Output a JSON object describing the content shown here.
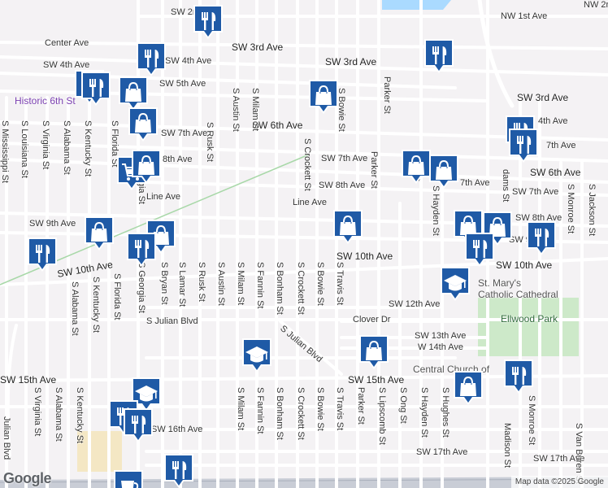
{
  "map": {
    "logo": "Google",
    "credit": "Map data ©2025 Google",
    "colors": {
      "water": "#aadaff",
      "park": "#cde9c9",
      "pin": "#1f5aa6",
      "road": "#ffffff",
      "highway": "#c9cdd6"
    }
  },
  "streets": {
    "sw_2nd": "SW 2nd Ave",
    "nw_1st": "NW 1st Ave",
    "nw_2nd": "NW 2n",
    "center": "Center Ave",
    "sw_3rd_a": "SW 3rd Ave",
    "sw_3rd_b": "SW 3rd Ave",
    "sw_3rd_c": "SW 3rd Ave",
    "sw_4th_a": "SW 4th Ave",
    "sw_4th_b": "SW 4th Ave",
    "sw_4th_c": "4th Ave",
    "sw_5th": "SW 5th Ave",
    "sw_6th_a": "SW 6th Ave",
    "sw_6th_b": "SW 6th Ave",
    "sw_7th_a": "SW 7th Ave",
    "sw_7th_b": "SW 7th Ave",
    "sw_7th_c": "SW 7th Ave",
    "sw_7th_d": "7th Ave",
    "sw_7th_e": "7th Ave",
    "sw_8th_a": "SW 8th Ave",
    "sw_8th_b": "SW 8th Ave",
    "sw_8th_c": "8th Ave",
    "line_a": "Line Ave",
    "line_b": "Line Ave",
    "sw_9th_a": "SW 9th Ave",
    "sw_9th_b": "SW 9",
    "sw_10th_a": "SW 10th Ave",
    "sw_10th_b": "SW 10th Ave",
    "sw_10th_c": "SW 10th Ave",
    "sw_12th": "SW 12th Ave",
    "sw_13th": "SW 13th Ave",
    "sw_14th": "W 14th Ave",
    "sw_15th_a": "SW 15th Ave",
    "sw_15th_b": "SW 15th Ave",
    "sw_16th": "SW 16th Ave",
    "sw_17th_a": "SW 17th Ave",
    "sw_17th_b": "SW 17th Ave",
    "julian_blvd": "S Julian Blvd",
    "julian_blvd_diag": "S Julian Blvd",
    "julian_blvd_left": "Julian Blvd",
    "clover": "Clover Dr",
    "mississippi": "S Mississippi St",
    "louisiana": "S Louisiana St",
    "virginia": "S Virginia St",
    "alabama": "S Alabama St",
    "kentucky": "S Kentucky St",
    "florida": "S Florida St",
    "georgia": "S Georgia St",
    "rusk_n": "S Rusk St",
    "austin_n": "S Austin St",
    "milam_n": "S Milam St",
    "crockett_n": "S Crockett St",
    "bowie_n": "S Bowie St",
    "parker_n": "Parker St",
    "parker_m": "Parker St",
    "alabama_w": "S Alabama St",
    "kentucky_w": "S Kentucky St",
    "florida_w": "S Florida St",
    "georgia_w": "S Georgia St",
    "bryan": "S Bryan St",
    "lamar": "S Lamar St",
    "rusk_s": "S Rusk St",
    "austin_s": "S Austin St",
    "milam_s": "S Milam St",
    "fannin_s": "S Fannin St",
    "bonham_s": "S Bonham St",
    "crockett_s": "S Crockett St",
    "bowie_s": "S Bowie St",
    "travis_s": "S Travis St",
    "virginia_sw": "S Virginia St",
    "alabama_sw": "S Alabama St",
    "kentucky_sw": "S Kentucky St",
    "milam_ss": "S Milam St",
    "fannin_ss": "S Fannin St",
    "bonham_ss": "S Bonham St",
    "crockett_ss": "S Crockett St",
    "bowie_ss": "S Bowie St",
    "travis_ss": "S Travis St",
    "parker_ss": "Parker St",
    "lipscomb": "S Lipscomb St",
    "ong": "S Ong St",
    "hayden_n": "S Hayden St",
    "hayden_s": "S Hayden St",
    "hughes": "S Hughes St",
    "adams": "dams St",
    "monroe_n": "S Monroe St",
    "monroe_s": "S Monroe St",
    "jackson": "S Jackson St",
    "madison": "Madison St",
    "van_buren": "S Van Buren St",
    "s_st": "S"
  },
  "places": {
    "historic": "Historic 6th St",
    "cathedral_1": "St. Mary's",
    "cathedral_2": "Catholic Cathedral",
    "ellwood": "Ellwood Park",
    "central_church": "Central Church of"
  },
  "pins": [
    {
      "icon": "fork-knife-icon"
    },
    {
      "icon": "fork-knife-icon"
    },
    {
      "icon": "fork-knife-icon"
    },
    {
      "icon": "shopping-bag-icon"
    },
    {
      "icon": "fork-knife-icon"
    },
    {
      "icon": "shopping-bag-icon"
    },
    {
      "icon": "fork-knife-icon"
    },
    {
      "icon": "shopping-bag-icon"
    },
    {
      "icon": "shopping-cart-icon"
    },
    {
      "icon": "shopping-bag-icon"
    },
    {
      "icon": "fork-knife-icon"
    },
    {
      "icon": "shopping-bag-icon"
    },
    {
      "icon": "shopping-bag-icon"
    },
    {
      "icon": "fork-knife-icon"
    },
    {
      "icon": "fork-knife-icon"
    },
    {
      "icon": "shopping-bag-icon"
    },
    {
      "icon": "shopping-bag-icon"
    },
    {
      "icon": "shopping-bag-icon"
    },
    {
      "icon": "shopping-bag-icon"
    },
    {
      "icon": "fork-knife-icon"
    },
    {
      "icon": "shopping-bag-icon"
    },
    {
      "icon": "graduation-cap-icon"
    },
    {
      "icon": "graduation-cap-icon"
    },
    {
      "icon": "shopping-bag-icon"
    },
    {
      "icon": "fork-knife-icon"
    },
    {
      "icon": "shopping-bag-icon"
    },
    {
      "icon": "graduation-cap-icon"
    },
    {
      "icon": "fork-knife-icon"
    },
    {
      "icon": "fork-knife-icon"
    },
    {
      "icon": "fork-knife-icon"
    },
    {
      "icon": "coffee-cup-icon"
    }
  ]
}
